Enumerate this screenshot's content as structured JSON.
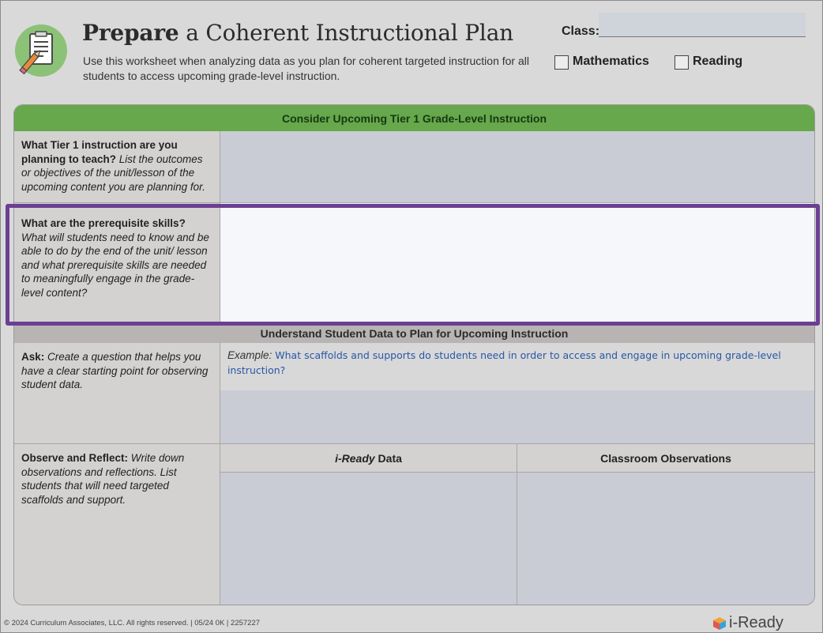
{
  "header": {
    "title_bold": "Prepare",
    "title_rest": " a Coherent Instructional Plan",
    "subtitle": "Use this worksheet when analyzing data as you plan for coherent targeted instruction for all students to access upcoming grade-level instruction.",
    "class_label": "Class:",
    "class_value": "",
    "subjects": [
      {
        "label": "Mathematics",
        "checked": false
      },
      {
        "label": "Reading",
        "checked": false
      }
    ]
  },
  "sections": {
    "tier1_header": "Consider Upcoming Tier 1 Grade-Level Instruction",
    "data_header": "Understand Student Data to Plan for Upcoming Instruction"
  },
  "rows": {
    "tier1": {
      "bold": "What Tier 1 instruction are you planning to teach?",
      "italic": " List the outcomes or objectives of the unit/lesson of the upcoming content you are planning for."
    },
    "prereq": {
      "bold": "What are the prerequisite skills?",
      "italic": "What will students need to know and be able to do by the end of the unit/ lesson and what prerequisite skills are needed to meaningfully engage in the grade-level content?"
    },
    "ask": {
      "bold": "Ask:",
      "italic": " Create a question that helps you have a clear starting point for observing student data.",
      "example_label": "Example:",
      "example_text": "What scaffolds and supports do students need in order to access and engage in upcoming grade-level instruction?"
    },
    "observe": {
      "bold": "Observe and Reflect:",
      "italic": " Write down observations and reflections. List students that will need targeted scaffolds and support.",
      "col1_italic": "i-Ready",
      "col1_rest": " Data",
      "col2": "Classroom Observations"
    }
  },
  "footer": {
    "copyright": "© 2024 Curriculum Associates, LLC. All rights reserved. | 05/24 0K | 2257227",
    "brand": "i-Ready"
  },
  "colors": {
    "green_band": "#66a84b",
    "highlight_border": "#6b3f93",
    "example_text": "#2957a6",
    "logo_green": "#8cc277"
  },
  "icons": {
    "logo": "notepad-pencil-icon",
    "brand": "i-ready-cube-icon"
  }
}
